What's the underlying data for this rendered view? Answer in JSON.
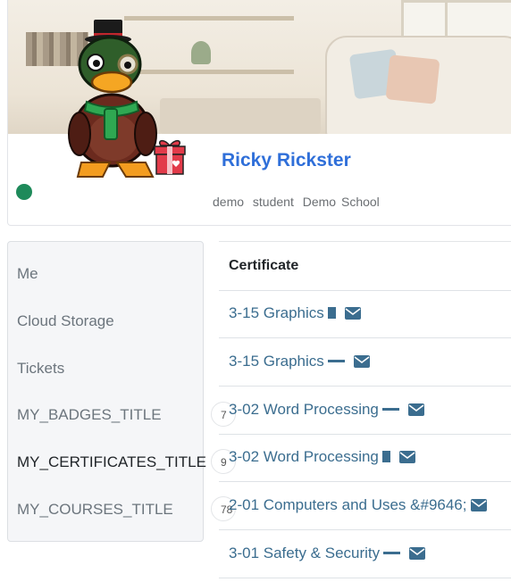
{
  "profile": {
    "name": "Ricky Rickster",
    "meta": [
      "demo",
      "student",
      "Demo School"
    ],
    "status_color": "#1e8a5a"
  },
  "sidebar": {
    "items": [
      {
        "label": "Me"
      },
      {
        "label": "Cloud Storage"
      },
      {
        "label": "Tickets"
      },
      {
        "label": "MY_BADGES_TITLE",
        "count": "7"
      },
      {
        "label": "MY_CERTIFICATES_TITLE",
        "count": "9",
        "active": true
      },
      {
        "label": "MY_COURSES_TITLE",
        "count": "78"
      }
    ]
  },
  "certificates": {
    "header": "Certificate",
    "rows": [
      {
        "title": "3-15 Graphics",
        "icon": "document-icon"
      },
      {
        "title": "3-15 Graphics",
        "icon": "dash-icon"
      },
      {
        "title": "3-02 Word Processing",
        "icon": "dash-icon"
      },
      {
        "title": "3-02 Word Processing",
        "icon": "document-icon"
      },
      {
        "title": "2-01 Computers and Uses &#9646;",
        "icon": "none"
      },
      {
        "title": "3-01 Safety & Security",
        "icon": "dash-icon"
      }
    ]
  },
  "colors": {
    "link": "#3b6d8f",
    "name": "#2f6fd9"
  }
}
